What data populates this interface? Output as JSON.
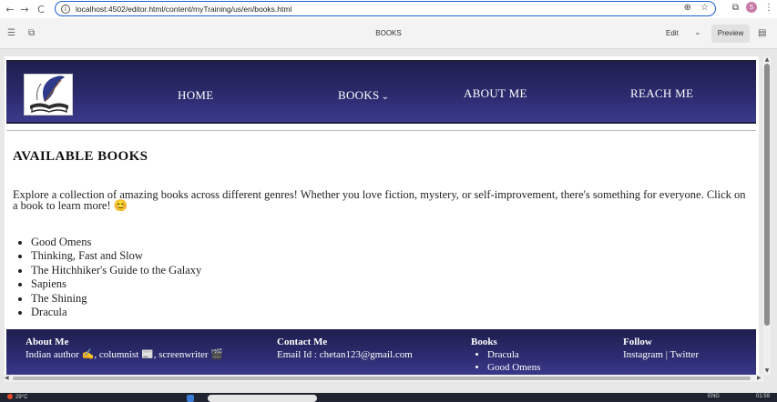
{
  "browser": {
    "url": "localhost:4502/editor.html/content/myTraining/us/en/books.html",
    "back_icon": "←",
    "forward_icon": "→",
    "reload_icon": "C",
    "profile_initial": "S"
  },
  "editor": {
    "page_title": "BOOKS",
    "mode": "Edit",
    "preview_label": "Preview"
  },
  "header": {
    "nav": [
      {
        "label": "HOME"
      },
      {
        "label": "BOOKS"
      },
      {
        "label": "ABOUT ME"
      },
      {
        "label": "REACH ME"
      }
    ]
  },
  "main": {
    "heading": "AVAILABLE  BOOKS",
    "intro": "Explore a collection of amazing books across different genres! Whether you love fiction, mystery, or self-improvement, there's something for everyone. Click on a book to learn more! 😊",
    "books": [
      "Good Omens",
      "Thinking, Fast and Slow",
      "The Hitchhiker's Guide to the Galaxy",
      "Sapiens",
      "The Shining",
      "Dracula"
    ]
  },
  "footer": {
    "about": {
      "title": "About Me",
      "text": "Indian author ✍️, columnist 📰, screenwriter 🎬"
    },
    "contact": {
      "title": "Contact Me",
      "text": "Email Id : chetan123@gmail.com"
    },
    "books": {
      "title": "Books",
      "items": [
        "Dracula",
        "Good Omens"
      ]
    },
    "follow": {
      "title": "Follow",
      "text": "Instagram | Twitter"
    }
  },
  "taskbar": {
    "weather": "29°C",
    "language": "ENG",
    "time": "01:59"
  }
}
